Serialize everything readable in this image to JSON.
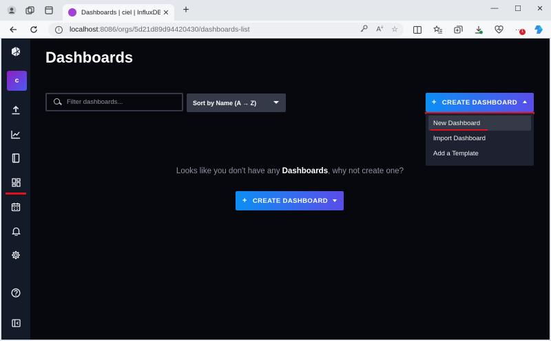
{
  "browser": {
    "tab_title": "Dashboards | ciel | InfluxDB",
    "tab_close": "✕",
    "new_tab": "+",
    "url_host": "localhost",
    "url_path": ":8086/orgs/5d21d89d94420430/dashboards-list",
    "window_controls": {
      "minimize": "—",
      "maximize": "☐",
      "close": "✕"
    },
    "extension_badge": "1",
    "more_label": "···"
  },
  "sidebar": {
    "org_initial": "c",
    "items": [
      {
        "name": "logo",
        "icon": "influx-logo-icon"
      },
      {
        "name": "upload",
        "icon": "upload-icon"
      },
      {
        "name": "explore",
        "icon": "graph-icon"
      },
      {
        "name": "notebooks",
        "icon": "notebook-icon"
      },
      {
        "name": "dashboards",
        "icon": "dashboards-icon"
      },
      {
        "name": "tasks",
        "icon": "calendar-icon"
      },
      {
        "name": "alerts",
        "icon": "bell-icon"
      },
      {
        "name": "settings",
        "icon": "gear-icon"
      },
      {
        "name": "help",
        "icon": "help-icon"
      },
      {
        "name": "collapse",
        "icon": "collapse-icon"
      }
    ]
  },
  "main": {
    "title": "Dashboards",
    "search_placeholder": "Filter dashboards...",
    "sort_label": "Sort by Name (A → Z)",
    "create_button": {
      "plus": "+",
      "label": "CREATE DASHBOARD"
    },
    "dropdown": [
      {
        "label": "New Dashboard",
        "active": true
      },
      {
        "label": "Import Dashboard",
        "active": false
      },
      {
        "label": "Add a Template",
        "active": false
      }
    ],
    "empty_state": {
      "prefix": "Looks like you don't have any ",
      "emphasis": "Dashboards",
      "suffix": ", why not create one?",
      "button_label": "CREATE DASHBOARD"
    }
  },
  "colors": {
    "accent_start": "#0b8ff4",
    "accent_end": "#5a4dea",
    "highlight": "#e0111e",
    "background": "#07070e",
    "sidebar": "#131a28"
  }
}
